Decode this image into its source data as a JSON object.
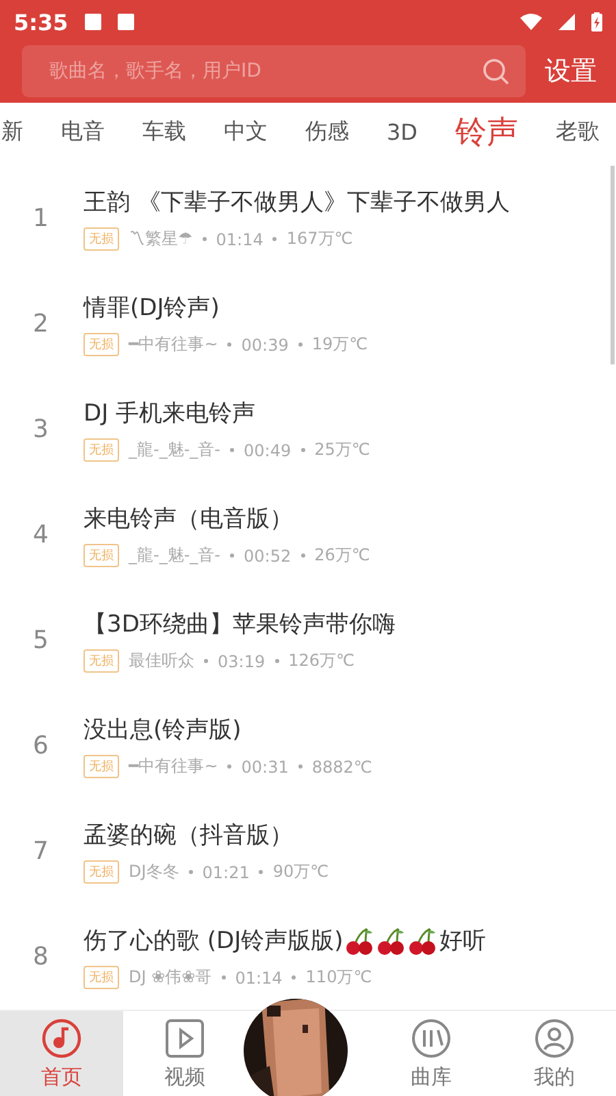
{
  "status_bar": {
    "time": "5:35"
  },
  "search": {
    "placeholder": "歌曲名，歌手名，用户ID"
  },
  "settings_label": "设置",
  "tabs": [
    {
      "label": "新",
      "selected": false
    },
    {
      "label": "电音",
      "selected": false
    },
    {
      "label": "车载",
      "selected": false
    },
    {
      "label": "中文",
      "selected": false
    },
    {
      "label": "伤感",
      "selected": false
    },
    {
      "label": "3D",
      "selected": false
    },
    {
      "label": "铃声",
      "selected": true
    },
    {
      "label": "老歌",
      "selected": false
    }
  ],
  "songs": [
    {
      "rank": "1",
      "title": "王韵 《下辈子不做男人》下辈子不做男人",
      "badge": "无损",
      "user": "〽繁星☂",
      "duration": "01:14",
      "heat": "167万℃"
    },
    {
      "rank": "2",
      "title": "情罪(DJ铃声)",
      "badge": "无损",
      "user": "━中有往事~",
      "duration": "00:39",
      "heat": "19万℃"
    },
    {
      "rank": "3",
      "title": "DJ 手机来电铃声",
      "badge": "无损",
      "user": "_龍-_魅-_音-",
      "duration": "00:49",
      "heat": "25万℃"
    },
    {
      "rank": "4",
      "title": "来电铃声（电音版）",
      "badge": "无损",
      "user": "_龍-_魅-_音-",
      "duration": "00:52",
      "heat": "26万℃"
    },
    {
      "rank": "5",
      "title": "【3D环绕曲】苹果铃声带你嗨",
      "badge": "无损",
      "user": "最佳听众",
      "duration": "03:19",
      "heat": "126万℃"
    },
    {
      "rank": "6",
      "title": "没出息(铃声版)",
      "badge": "无损",
      "user": "━中有往事~",
      "duration": "00:31",
      "heat": "8882℃"
    },
    {
      "rank": "7",
      "title": "孟婆的碗（抖音版）",
      "badge": "无损",
      "user": "DJ冬冬",
      "duration": "01:21",
      "heat": "90万℃"
    },
    {
      "rank": "8",
      "title": "伤了心的歌 (DJ铃声版版)",
      "decor": [
        {
          "kind": "cherry"
        },
        {
          "kind": "cherry"
        },
        {
          "kind": "cherry"
        }
      ],
      "suffix": "好听",
      "user": "DJ ❀伟❀哥",
      "duration": "01:14",
      "heat": "110万℃",
      "badge": "无损"
    }
  ],
  "nav": [
    {
      "kind": "note",
      "label": "首页",
      "selected": true
    },
    {
      "kind": "play",
      "label": "视频",
      "selected": false
    },
    {
      "kind": "disc"
    },
    {
      "kind": "library",
      "label": "曲库",
      "selected": false
    },
    {
      "kind": "user",
      "label": "我的",
      "selected": false
    }
  ]
}
